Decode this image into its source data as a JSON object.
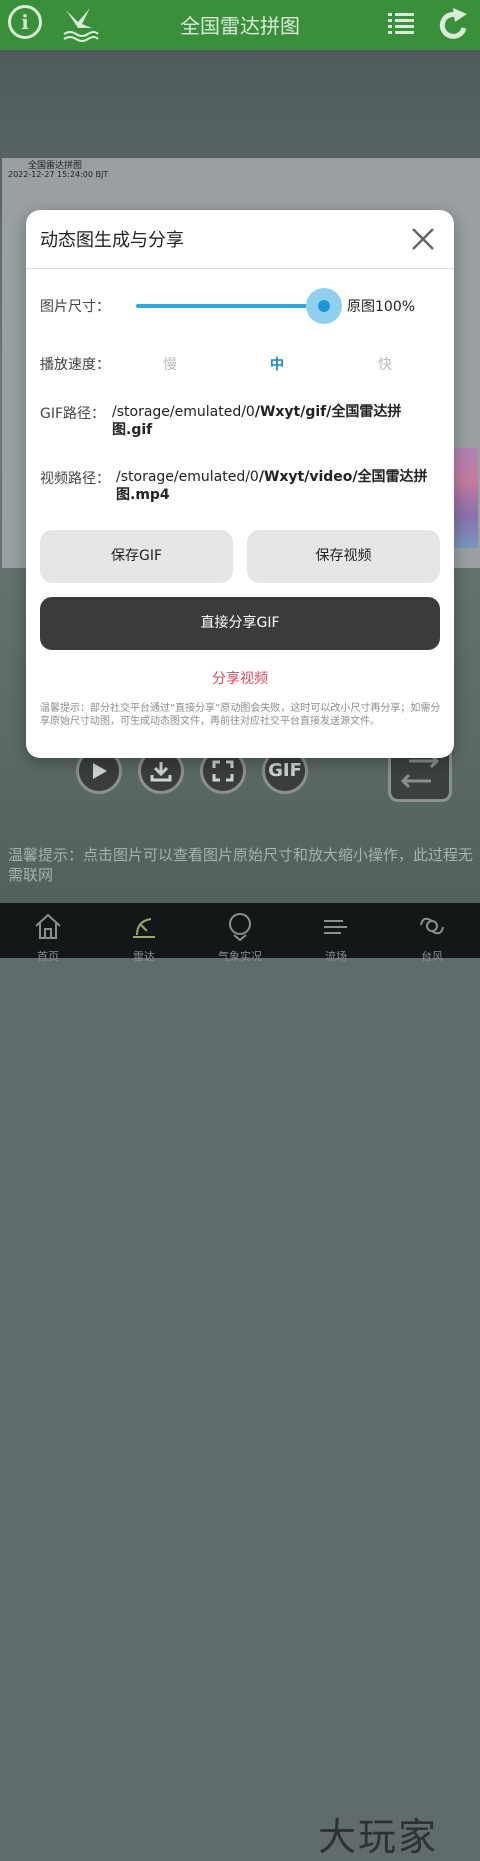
{
  "header": {
    "title": "全国雷达拼图",
    "info_glyph": "i"
  },
  "map": {
    "title": "全国雷达拼图",
    "time": "2022-12-27 15:24:00 BJT"
  },
  "controls": {
    "gif_label": "GIF"
  },
  "background_tip": "温馨提示：点击图片可以查看图片原始尺寸和放大缩小操作，此过程无需联网",
  "nav": {
    "items": [
      {
        "label": "首页"
      },
      {
        "label": "雷达"
      },
      {
        "label": "气象实况"
      },
      {
        "label": "流场"
      },
      {
        "label": "台风"
      }
    ],
    "watermark": "大玩家"
  },
  "dialog": {
    "title": "动态图生成与分享",
    "size_label": "图片尺寸：",
    "size_value": "原图100%",
    "size_fraction": 1.0,
    "speed_label": "播放速度：",
    "speed_options": [
      "慢",
      "中",
      "快"
    ],
    "speed_selected": "中",
    "gif_path_label": "GIF路径：",
    "gif_path_prefix": "/storage/emulated/0",
    "gif_path_rest_line1": "/Wxyt/gif/全国雷达拼",
    "gif_path_rest_line2": "图.gif",
    "video_path_label": "视频路径：",
    "video_path_prefix": "/storage/emulated/0",
    "video_path_rest_line1": "/Wxyt/video/全国雷达拼",
    "video_path_rest_line2": "图.mp4",
    "save_gif": "保存GIF",
    "save_video": "保存视频",
    "share_gif": "直接分享GIF",
    "share_video": "分享视频",
    "tip": "温馨提示：部分社交平台通过“直接分享”原动图会失败，这时可以改小尺寸再分享；如需分享原始尺寸动图，可生成动态图文件，再前往对应社交平台直接发送源文件。"
  },
  "colors": {
    "header": "#3a8f3a",
    "accent": "#1c97d4",
    "share_video": "#d64a63"
  }
}
